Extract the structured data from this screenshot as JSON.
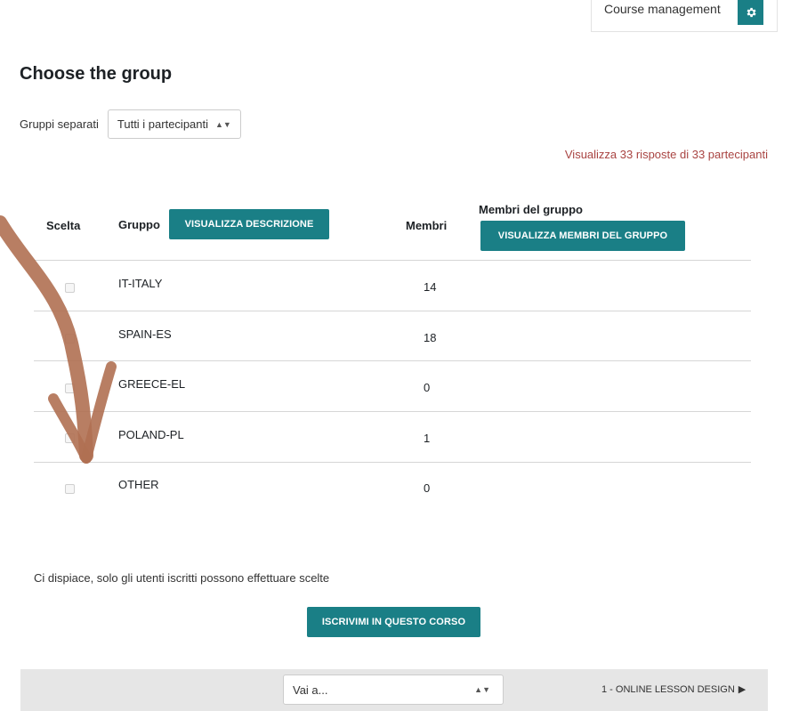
{
  "header": {
    "course_management_label": "Course management",
    "gear_icon": "gear-icon"
  },
  "page": {
    "title": "Choose the group",
    "group_mode_label": "Gruppi separati",
    "group_mode_value": "Tutti i partecipanti",
    "responses_note": "Visualizza 33 risposte di 33 partecipanti"
  },
  "table": {
    "headers": {
      "scelta": "Scelta",
      "gruppo": "Gruppo",
      "show_description": "VISUALIZZA DESCRIZIONE",
      "membri": "Membri",
      "membri_del_gruppo": "Membri del gruppo",
      "show_members": "VISUALIZZA MEMBRI DEL GRUPPO"
    },
    "rows": [
      {
        "name": "IT-ITALY",
        "count": "14"
      },
      {
        "name": "SPAIN-ES",
        "count": "18"
      },
      {
        "name": "GREECE-EL",
        "count": "0"
      },
      {
        "name": "POLAND-PL",
        "count": "1"
      },
      {
        "name": "OTHER",
        "count": "0"
      }
    ]
  },
  "enrol": {
    "message": "Ci dispiace, solo gli utenti iscritti possono effettuare scelte",
    "button": "ISCRIVIMI IN QUESTO CORSO"
  },
  "footer": {
    "jump_placeholder": "Vai a...",
    "next_link": "1 - ONLINE LESSON DESIGN"
  },
  "colors": {
    "accent": "#1a7f86",
    "note_red": "#a94442",
    "annotation_arrow": "#b07052"
  }
}
